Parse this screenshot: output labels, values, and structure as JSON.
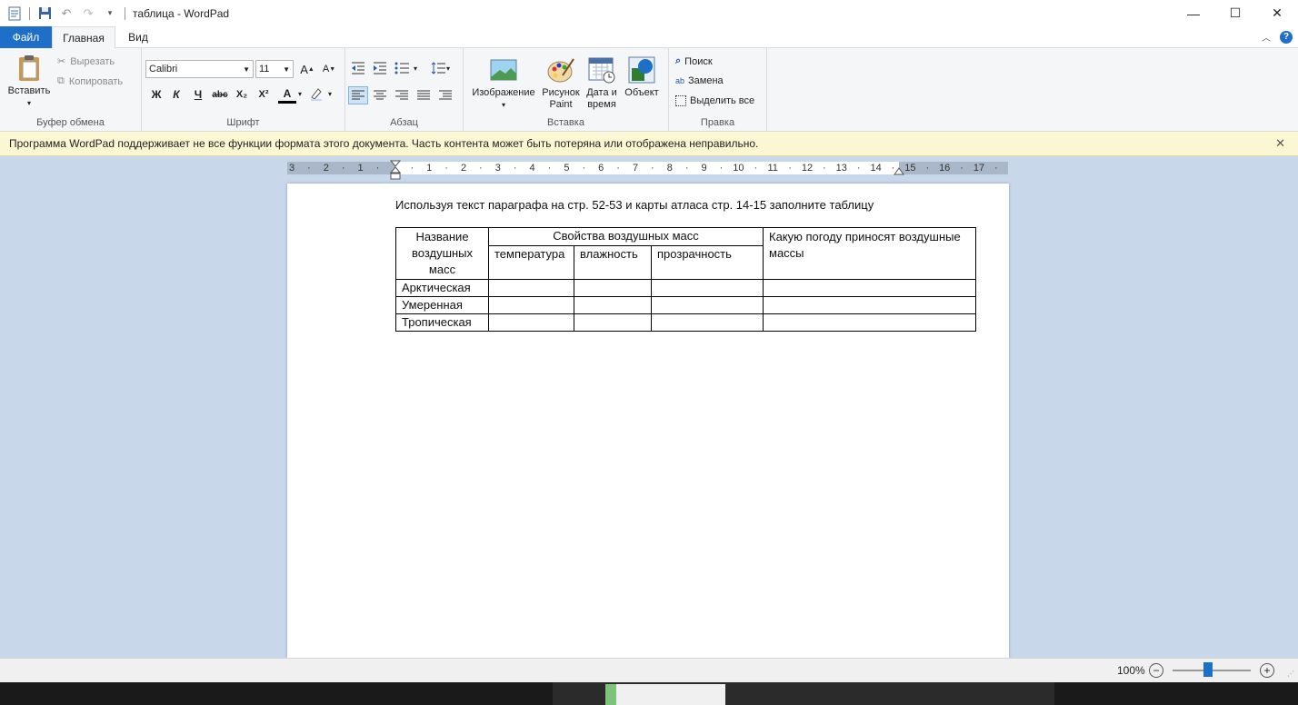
{
  "window": {
    "title": "таблица - WordPad",
    "controls": {
      "minimize": "—",
      "maximize": "☐",
      "close": "✕"
    }
  },
  "tabs": {
    "file": "Файл",
    "home": "Главная",
    "view": "Вид"
  },
  "ribbon": {
    "clipboard": {
      "label": "Буфер обмена",
      "paste": "Вставить",
      "cut": "Вырезать",
      "copy": "Копировать"
    },
    "font": {
      "label": "Шрифт",
      "family": "Calibri",
      "size": "11",
      "bold": "Ж",
      "italic": "К",
      "underline": "Ч",
      "strike": "abc",
      "subscript": "X₂",
      "superscript": "X²",
      "color": "A",
      "grow": "A",
      "shrink": "A"
    },
    "paragraph": {
      "label": "Абзац"
    },
    "insert": {
      "label": "Вставка",
      "image": "Изображение",
      "paint_line1": "Рисунок",
      "paint_line2": "Paint",
      "datetime_line1": "Дата и",
      "datetime_line2": "время",
      "object": "Объект"
    },
    "editing": {
      "label": "Правка",
      "find": "Поиск",
      "replace": "Замена",
      "select_all": "Выделить все"
    }
  },
  "notice": {
    "text": "Программа WordPad поддерживает не все функции формата этого документа. Часть контента может быть потеряна или отображена неправильно.",
    "close": "✕"
  },
  "ruler": {
    "ticks": [
      "3",
      "·",
      "2",
      "·",
      "1",
      "·",
      "",
      "·",
      "1",
      "·",
      "2",
      "·",
      "3",
      "·",
      "4",
      "·",
      "5",
      "·",
      "6",
      "·",
      "7",
      "·",
      "8",
      "·",
      "9",
      "·",
      "10",
      "·",
      "11",
      "·",
      "12",
      "·",
      "13",
      "·",
      "14",
      "·",
      "15",
      "·",
      "16",
      "·",
      "17",
      "·"
    ]
  },
  "document": {
    "heading": "Используя текст параграфа на стр. 52-53 и карты атласа стр. 14-15 заполните таблицу",
    "table": {
      "header_name": "Название воздушных масс",
      "header_props": "Свойства воздушных масс",
      "header_weather": "Какую погоду приносят воздушные массы",
      "sub_temperature": "температура",
      "sub_humidity": "влажность",
      "sub_transparency": "прозрачность",
      "rows": [
        "Арктическая",
        "Умеренная",
        "Тропическая"
      ]
    }
  },
  "status": {
    "zoom": "100%",
    "zoom_out": "−",
    "zoom_in": "+",
    "zoom_level": 0.45
  },
  "colors": {
    "accent": "#1e6fc8",
    "notice_bg": "#fcf7d3",
    "workspace": "#c8d7ea"
  }
}
